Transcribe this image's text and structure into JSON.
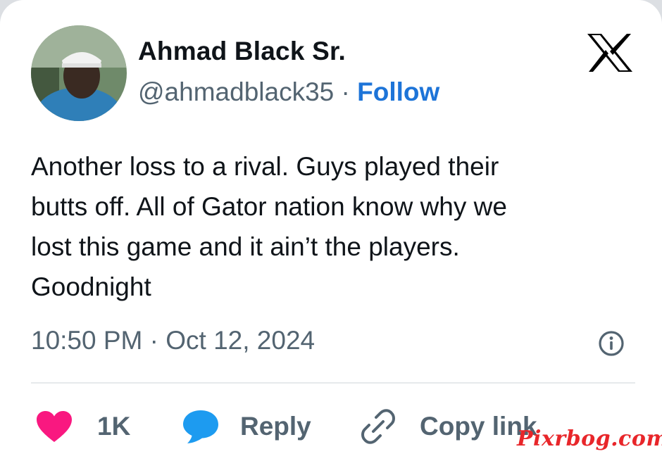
{
  "author": {
    "name": "Ahmad Black Sr.",
    "handle": "@ahmadblack35",
    "separator": "·",
    "follow_label": "Follow"
  },
  "platform_logo": "x-logo",
  "tweet": {
    "text": "Another loss to a rival. Guys played their\nbutts off. All of Gator nation know why we\nlost this game and it ain’t the players.\nGoodnight",
    "timestamp": "10:50 PM · Oct 12, 2024"
  },
  "actions": {
    "like_count": "1K",
    "reply_label": "Reply",
    "copy_link_label": "Copy link"
  },
  "icons": [
    "heart-icon",
    "reply-bubble-icon",
    "link-icon",
    "info-icon",
    "x-logo-icon"
  ],
  "colors": {
    "follow_blue": "#1d74d8",
    "heart_pink": "#f91880",
    "reply_blue": "#1d9bf0",
    "muted_text": "#536471",
    "watermark_red": "#e8262a"
  },
  "watermark": "Pixrbog.com"
}
